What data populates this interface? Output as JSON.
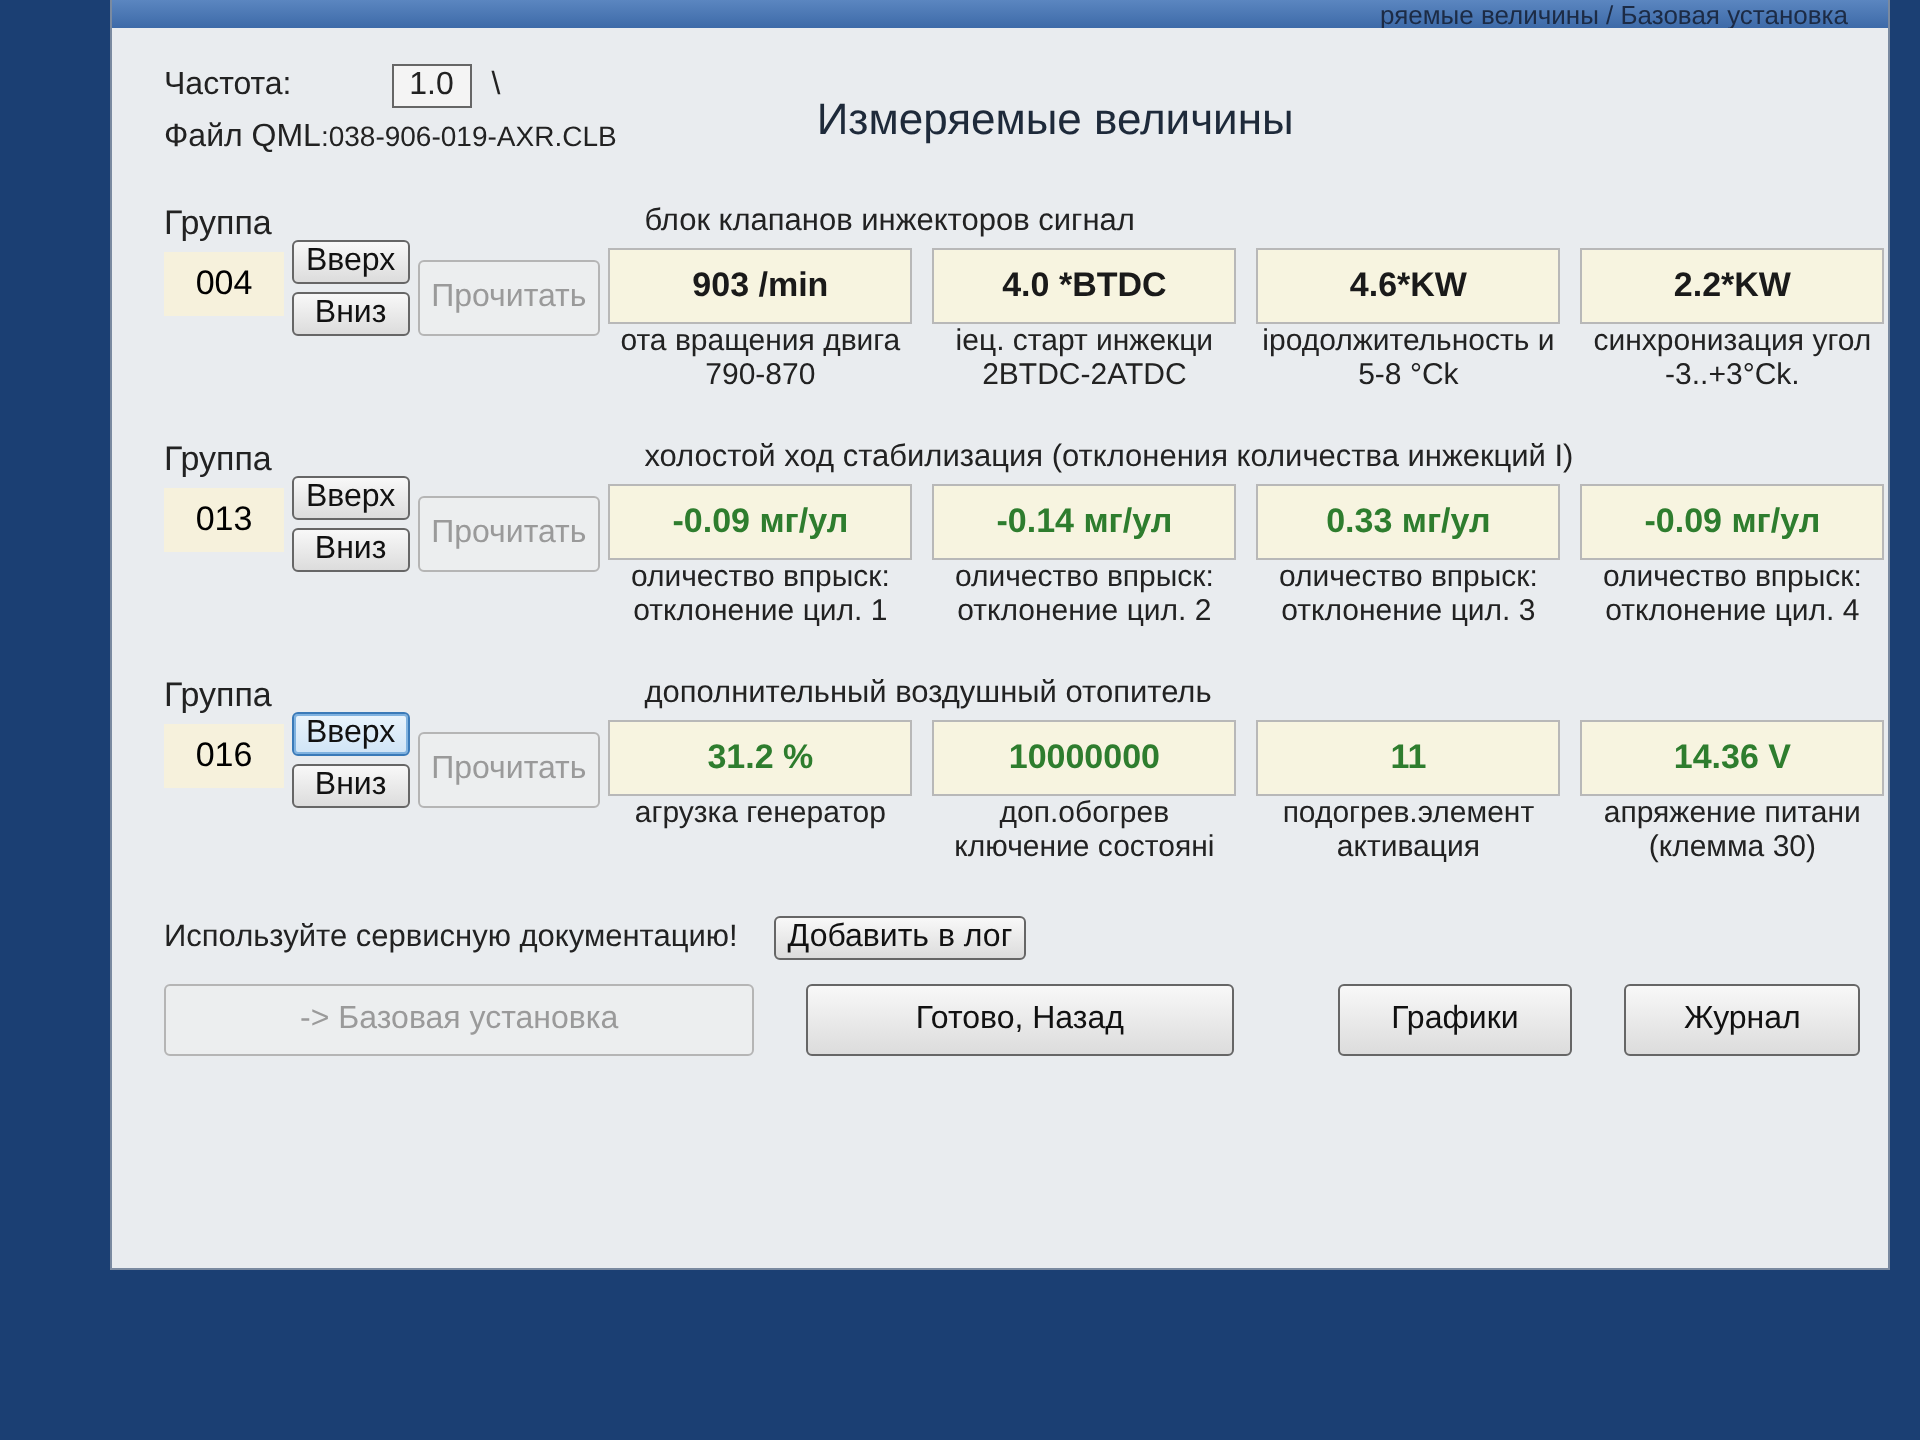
{
  "window": {
    "title": "ряемые величины / Базовая установка"
  },
  "rate": {
    "label": "Частота:",
    "value": "1.0",
    "spinner": "\\"
  },
  "heading": "Измеряемые величины",
  "file": {
    "label": "Файл QML",
    "value": ":038-906-019-AXR.CLB"
  },
  "groups": [
    {
      "label": "Группа",
      "number": "004",
      "up": {
        "label": "Вверх",
        "focused": false
      },
      "down": "Вниз",
      "read": {
        "label": "Прочитать",
        "disabled": true
      },
      "title": "блок клапанов инжекторов сигнал",
      "color": "#1a1a1a",
      "fields": [
        {
          "value": "903 /min",
          "name": "ота вращения двига",
          "spec": "790-870"
        },
        {
          "value": "4.0 *BTDC",
          "name": "іец. старт инжекци",
          "spec": "2BTDC-2ATDC"
        },
        {
          "value": "4.6*KW",
          "name": "іродолжительность и",
          "spec": "5-8 °Ck"
        },
        {
          "value": "2.2*KW",
          "name": "синхронизация угол",
          "spec": "-3..+3°Ck."
        }
      ]
    },
    {
      "label": "Группа",
      "number": "013",
      "up": {
        "label": "Вверх",
        "focused": false
      },
      "down": "Вниз",
      "read": {
        "label": "Прочитать",
        "disabled": true
      },
      "title": "холостой ход стабилизация (отклонения количества инжекций I)",
      "color": "#2e7d2e",
      "fields": [
        {
          "value": "-0.09 мг/ул",
          "name": "оличество впрыск:",
          "spec": "отклонение цил. 1"
        },
        {
          "value": "-0.14 мг/ул",
          "name": "оличество впрыск:",
          "spec": "отклонение цил. 2"
        },
        {
          "value": "0.33 мг/ул",
          "name": "оличество впрыск:",
          "spec": "отклонение цил. 3"
        },
        {
          "value": "-0.09 мг/ул",
          "name": "оличество впрыск:",
          "spec": "отклонение цил. 4"
        }
      ]
    },
    {
      "label": "Группа",
      "number": "016",
      "up": {
        "label": "Вверх",
        "focused": true
      },
      "down": "Вниз",
      "read": {
        "label": "Прочитать",
        "disabled": true
      },
      "title": "дополнительный воздушный отопитель",
      "color": "#2e7d2e",
      "fields": [
        {
          "value": "31.2 %",
          "name": "агрузка генератор"
        },
        {
          "value": "10000000",
          "name": "доп.обогрев",
          "spec": "ключение состояні"
        },
        {
          "value": "11",
          "name": "подогрев.элемент",
          "spec": "активация"
        },
        {
          "value": "14.36 V",
          "name": "апряжение питани",
          "spec": "(клемма 30)"
        }
      ]
    }
  ],
  "note": "Используйте сервисную документацию!",
  "log_button": "Добавить в лог",
  "basic_setting": {
    "label": "-> Базовая установка",
    "disabled": true
  },
  "buttons": [
    "Готово, Назад",
    "Графики",
    "Журнал"
  ]
}
